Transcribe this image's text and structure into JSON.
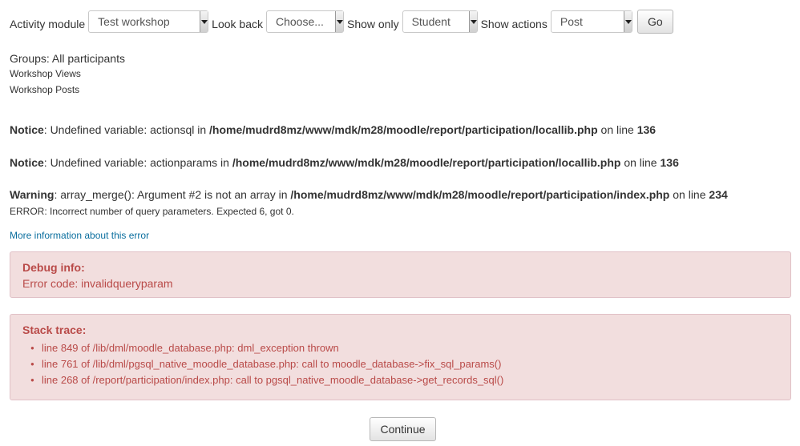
{
  "filters": {
    "activity_module": {
      "label": "Activity module",
      "value": "Test workshop"
    },
    "look_back": {
      "label": "Look back",
      "value": "Choose..."
    },
    "show_only": {
      "label": "Show only",
      "value": "Student"
    },
    "show_actions": {
      "label": "Show actions",
      "value": "Post"
    },
    "go_label": "Go"
  },
  "groups_text": "Groups: All participants",
  "links": {
    "workshop_views": "Workshop Views",
    "workshop_posts": "Workshop Posts"
  },
  "notices": [
    {
      "level": "Notice",
      "pre": ": Undefined variable: actionsql in ",
      "file": "/home/mudrd8mz/www/mdk/m28/moodle/report/participation/locallib.php",
      "on": " on line ",
      "line": "136"
    },
    {
      "level": "Notice",
      "pre": ": Undefined variable: actionparams in ",
      "file": "/home/mudrd8mz/www/mdk/m28/moodle/report/participation/locallib.php",
      "on": " on line ",
      "line": "136"
    },
    {
      "level": "Warning",
      "pre": ": array_merge(): Argument #2 is not an array in ",
      "file": "/home/mudrd8mz/www/mdk/m28/moodle/report/participation/index.php",
      "on": " on line ",
      "line": "234"
    }
  ],
  "error_message": "ERROR: Incorrect number of query parameters. Expected 6, got 0.",
  "more_info_link": "More information about this error",
  "debug_info": {
    "title": "Debug info:",
    "text": "Error code: invalidqueryparam"
  },
  "stack_trace": {
    "title": "Stack trace:",
    "items": [
      "line 849 of /lib/dml/moodle_database.php: dml_exception thrown",
      "line 761 of /lib/dml/pgsql_native_moodle_database.php: call to moodle_database->fix_sql_params()",
      "line 268 of /report/participation/index.php: call to pgsql_native_moodle_database->get_records_sql()"
    ]
  },
  "continue_label": "Continue",
  "colors": {
    "alert_bg": "#f2dede",
    "alert_text": "#b94a48",
    "link": "#0a6e9e"
  }
}
